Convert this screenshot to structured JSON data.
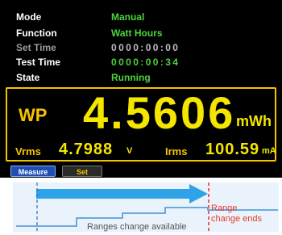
{
  "status": {
    "mode_label": "Mode",
    "mode_value": "Manual",
    "function_label": "Function",
    "function_value": "Watt Hours",
    "set_time_label": "Set Time",
    "set_time_value": "0000:00:00",
    "test_time_label": "Test Time",
    "test_time_value": "0000:00:34",
    "state_label": "State",
    "state_value": "Running"
  },
  "measurement": {
    "primary_label": "WP",
    "primary_value": "4.5606",
    "primary_unit": "mWh",
    "vrms_label": "Vrms",
    "vrms_value": "4.7988",
    "vrms_unit": "V",
    "irms_label": "Irms",
    "irms_value": "100.59",
    "irms_unit": "mA"
  },
  "softkeys": {
    "measure": "Measure",
    "set": "Set"
  },
  "diagram": {
    "ranges_available": "Ranges change available",
    "range_change_ends_line1": "Range",
    "range_change_ends_line2": "change ends"
  },
  "colors": {
    "green": "#4cd43a",
    "yellow": "#f5e600",
    "frame": "#f5c400",
    "arrow": "#2ea3e8",
    "marker": "#e83a2e"
  }
}
